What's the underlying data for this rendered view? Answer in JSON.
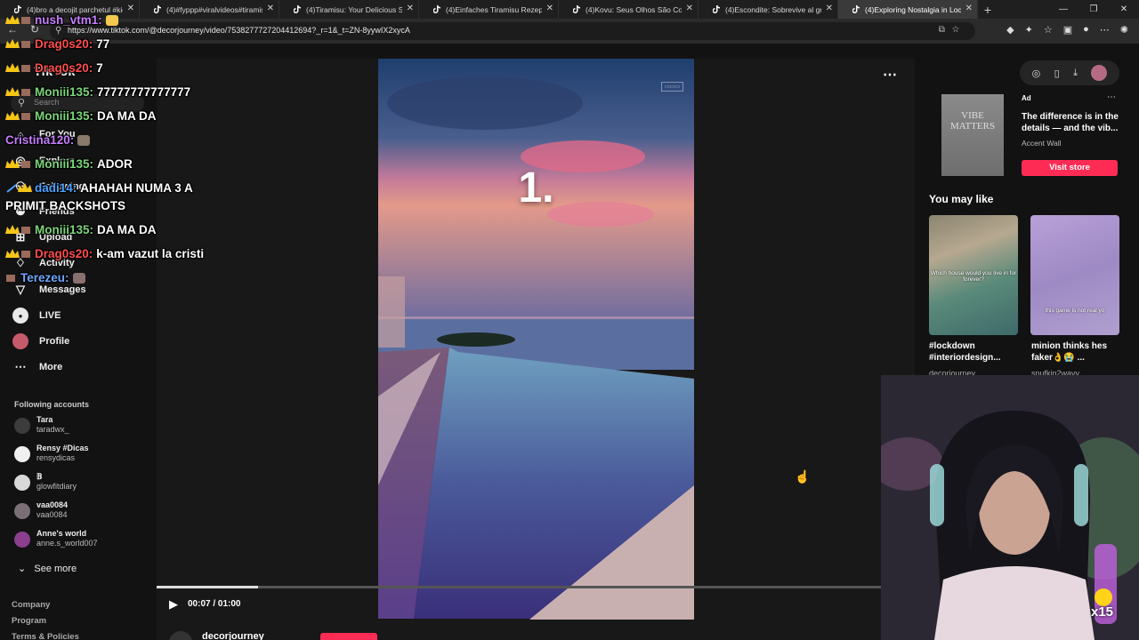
{
  "browser": {
    "tabs": [
      {
        "label": "(4)bro a decojit parchetul #kickst"
      },
      {
        "label": "(4)#fyppp#viralvideos#tiramisu#"
      },
      {
        "label": "(4)Tiramisu: Your Delicious Sign t"
      },
      {
        "label": "(4)Einfaches Tiramisu Rezept mit"
      },
      {
        "label": "(4)Kovu: Seus Olhos São Como o"
      },
      {
        "label": "(4)Escondite: Sobrevive al grito |"
      },
      {
        "label": "(4)Exploring Nostalgia in Lockdo"
      }
    ],
    "url": "https://www.tiktok.com/@decorjourney/video/7538277727204412694?_r=1&_t=ZN-8yywIX2xycA"
  },
  "sidebar": {
    "logo": "TikTok",
    "search_placeholder": "Search",
    "nav": [
      {
        "label": "For You"
      },
      {
        "label": "Explore"
      },
      {
        "label": "Following"
      },
      {
        "label": "Friends"
      },
      {
        "label": "Upload"
      },
      {
        "label": "Activity"
      },
      {
        "label": "Messages"
      },
      {
        "label": "LIVE"
      },
      {
        "label": "Profile"
      },
      {
        "label": "More"
      }
    ],
    "following_header": "Following accounts",
    "accounts": [
      {
        "name": "Tara",
        "handle": "taradwx_",
        "color": "#3c3c3c"
      },
      {
        "name": "Rensy #Dicas",
        "handle": "rensydicas",
        "color": "#f0f0f0"
      },
      {
        "name": "𝔹",
        "handle": "glowfitdiary",
        "color": "#d8d8d8"
      },
      {
        "name": "vaa0084",
        "handle": "vaa0084",
        "color": "#7a6f75"
      },
      {
        "name": "Anne's world",
        "handle": "anne.s_world007",
        "color": "#8b3f8c"
      }
    ],
    "see_more": "See more",
    "footer": [
      "Company",
      "Program",
      "Terms & Policies"
    ]
  },
  "video": {
    "overlay_text": "1.",
    "time": "00:07 / 01:00",
    "progress": 0.14,
    "author": "decorjourney"
  },
  "right": {
    "ad": {
      "label": "Ad",
      "image_text": "VIBE MATTERS",
      "text": "The difference is in the details — and the vib...",
      "brand": "Accent Wall",
      "cta": "Visit store"
    },
    "you_may_like": "You may like",
    "recs": [
      {
        "title": "#lockdown #interiordesign...",
        "author": "decorjourney",
        "caption": "Which house would you live in for forever?"
      },
      {
        "title": "minion thinks hes faker👌😭 ...",
        "author": "snufkin2wavy",
        "caption": "this game is not real yo"
      }
    ]
  },
  "stream": {
    "gift_count": "x15"
  },
  "chat": [
    {
      "user": "nush_vtm1:",
      "text": "",
      "color": "#c77dff",
      "emote": "#f2c94c"
    },
    {
      "user": "Drag0s20:",
      "text": "77",
      "color": "#ff4d4d"
    },
    {
      "user": "Drag0s20:",
      "text": "7",
      "color": "#ff4d4d"
    },
    {
      "user": "Moniii135:",
      "text": "77777777777777",
      "color": "#7cd67c"
    },
    {
      "user": "Moniii135:",
      "text": "DA MA DA",
      "color": "#7cd67c"
    },
    {
      "user": "Cristina120:",
      "text": "",
      "color": "#c77dff",
      "emote": "#8a7a6a"
    },
    {
      "user": "Moniii135:",
      "text": "ADOR",
      "color": "#7cd67c"
    },
    {
      "user": "dadi14:",
      "text": "AHAHAH NUMA 3 A",
      "color": "#4da3ff"
    },
    {
      "user": "",
      "text": "PRIMIT BACKSHOTS",
      "color": "#ffffff"
    },
    {
      "user": "Moniii135:",
      "text": "DA MA DA",
      "color": "#7cd67c"
    },
    {
      "user": "Drag0s20:",
      "text": "k-am vazut la cristi",
      "color": "#ff4d4d"
    },
    {
      "user": "Terezeu:",
      "text": "",
      "color": "#6fa8ff",
      "emote": "#8a6f6f"
    }
  ]
}
